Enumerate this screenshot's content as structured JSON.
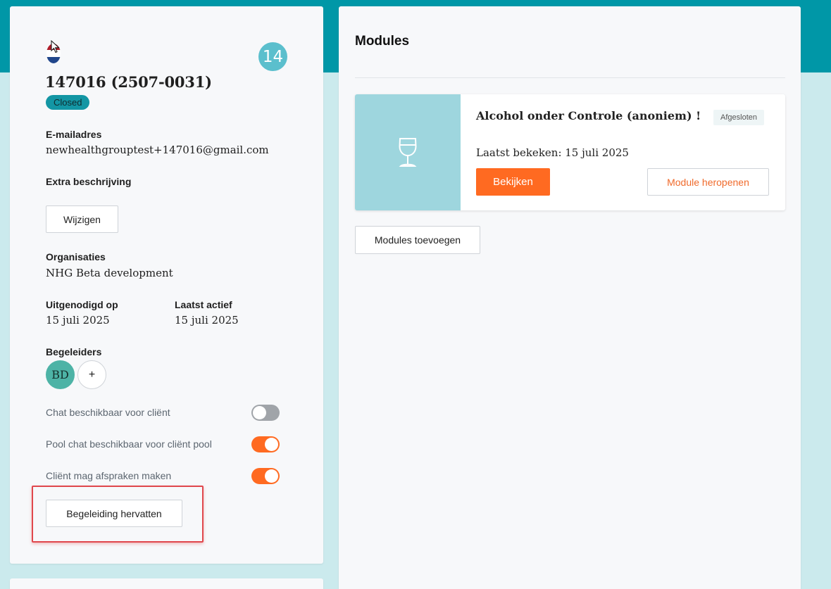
{
  "client": {
    "count_badge": "14",
    "id_label": "147016 (2507-0031)",
    "status": "Closed",
    "email_label": "E-mailadres",
    "email": "newhealthgrouptest+147016@gmail.com",
    "extra_description_label": "Extra beschrijving",
    "edit_button": "Wijzigen",
    "organisations_label": "Organisaties",
    "organisation": "NHG Beta development",
    "invited_label": "Uitgenodigd op",
    "invited_date": "15 juli 2025",
    "last_active_label": "Laatst actief",
    "last_active_date": "15 juli 2025",
    "supervisors_label": "Begeleiders",
    "supervisor_initials": "BD",
    "add_supervisor": "+",
    "toggles": [
      {
        "label": "Chat beschikbaar voor cliënt",
        "on": false
      },
      {
        "label": "Pool chat beschikbaar voor cliënt pool",
        "on": true
      },
      {
        "label": "Cliënt mag afspraken maken",
        "on": true
      }
    ],
    "resume_button": "Begeleiding hervatten"
  },
  "modules": {
    "title": "Modules",
    "items": [
      {
        "title": "Alcohol onder Controle (anoniem) !",
        "status": "Afgesloten",
        "last_viewed": "Laatst bekeken: 15 juli 2025",
        "view_button": "Bekijken",
        "reopen_button": "Module heropenen"
      }
    ],
    "add_button": "Modules toevoegen"
  },
  "colors": {
    "accent_orange": "#ff6a21",
    "header_teal": "#0097a7",
    "background": "#cbeaed",
    "badge_teal": "#1396a4"
  }
}
